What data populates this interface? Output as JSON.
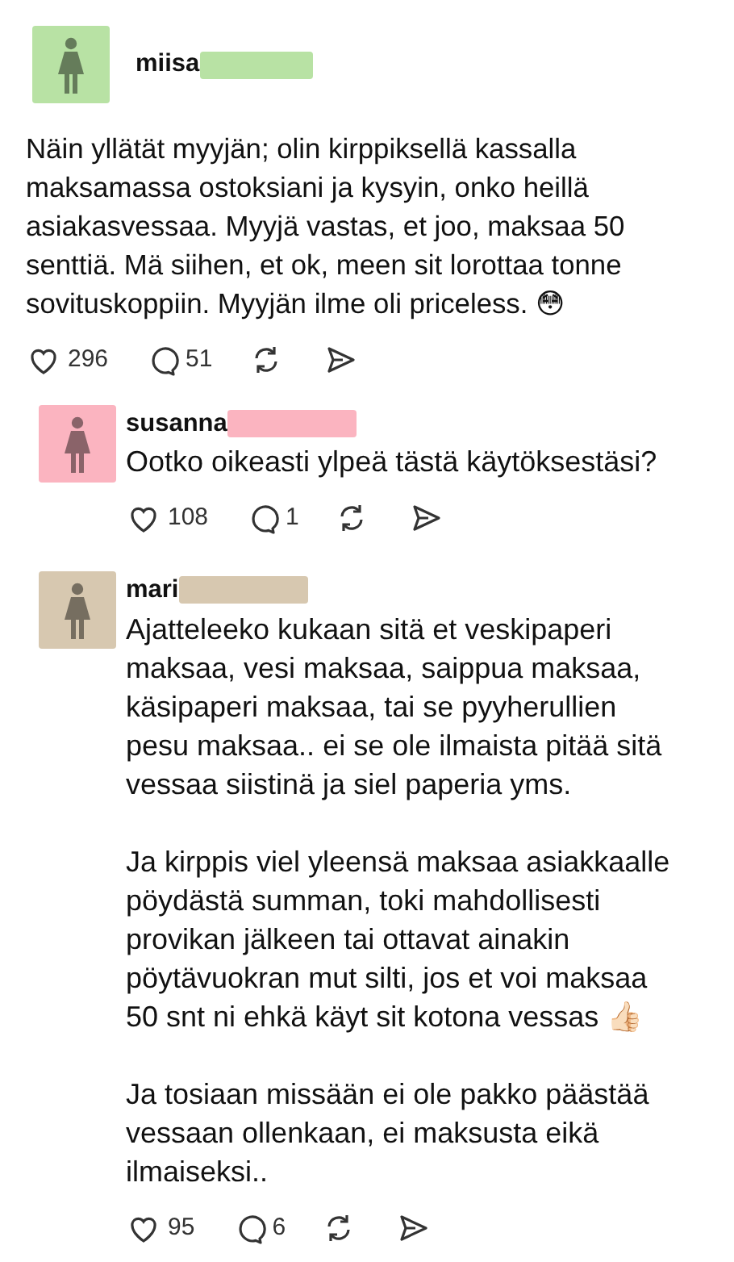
{
  "post": {
    "author": "miisa",
    "color": "#b8e2a4",
    "paragraphs": [
      "Näin yllätät myyjän; olin kirppiksellä kassalla maksamassa ostoksiani ja kysyin, onko heillä asiakasvessaa. Myyjä vastas, et joo, maksaa 50 senttiä. Mä siihen, et ok, meen sit lorottaa tonne sovituskoppiin. Myyjän ilme oli priceless. 😳"
    ],
    "likes": "296",
    "comments": "51"
  },
  "replies": [
    {
      "author": "susanna",
      "color": "#fbb4c0",
      "paragraphs": [
        "Ootko oikeasti ylpeä tästä käytöksestäsi?"
      ],
      "likes": "108",
      "comments": "1"
    },
    {
      "author": "mari",
      "color": "#d7c8b0",
      "paragraphs": [
        "Ajatteleeko kukaan sitä et veskipaperi maksaa, vesi maksaa, saippua maksaa, käsipaperi maksaa, tai se pyyherullien pesu maksaa.. ei se ole ilmaista pitää sitä vessaa siistinä ja siel paperia yms.",
        "Ja kirppis viel yleensä maksaa asiakkaalle pöydästä summan, toki mahdollisesti provikan jälkeen tai ottavat ainakin pöytävuokran mut silti, jos et voi maksaa 50 snt ni ehkä käyt sit kotona vessas 👍🏻",
        "Ja tosiaan missään ei ole pakko päästää vessaan ollenkaan, ei maksusta eikä ilmaiseksi.."
      ],
      "likes": "95",
      "comments": "6"
    }
  ]
}
